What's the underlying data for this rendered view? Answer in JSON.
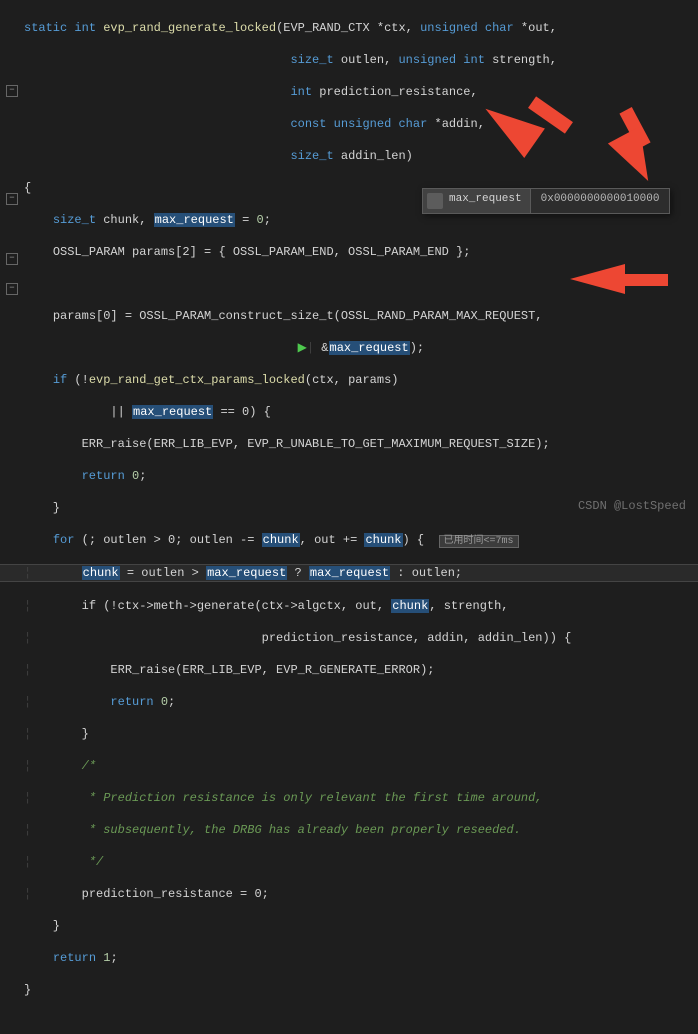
{
  "signature": {
    "keywords": {
      "static": "static",
      "int": "int",
      "unsigned": "unsigned",
      "char": "char",
      "const": "const",
      "size_t": "size_t"
    },
    "fn_name": "evp_rand_generate_locked",
    "params": {
      "p1": "(EVP_RAND_CTX *ctx, ",
      "p2": "*out,",
      "p3": "outlen, ",
      "p4": "strength,",
      "p5": "prediction_resistance,",
      "p6": "*addin,",
      "p7": "addin_len)"
    }
  },
  "body": {
    "decl": {
      "var1": "chunk",
      "var2": "max_request",
      "zero": "0"
    },
    "params_line": "OSSL_PARAM params[2] = { OSSL_PARAM_END, OSSL_PARAM_END };",
    "construct": {
      "lhs": "params[0] = OSSL_PARAM_construct_size_t(OSSL_RAND_PARAM_MAX_REQUEST,",
      "rhs_amp": "&",
      "rhs_var": "max_request",
      "rhs_close": ");"
    },
    "if1": {
      "cond_a": "(!",
      "fn": "evp_rand_get_ctx_params_locked",
      "args": "(ctx, params)",
      "or": "|| ",
      "var": "max_request",
      "eq": " == 0) {"
    },
    "err1": "ERR_raise(ERR_LIB_EVP, EVP_R_UNABLE_TO_GET_MAXIMUM_REQUEST_SIZE);",
    "ret0": "return",
    "ret0_val": "0",
    "for": {
      "head_a": "for",
      "head_b": " (; outlen > 0; outlen -= ",
      "chunk1": "chunk",
      "head_c": ", out += ",
      "chunk2": "chunk",
      "head_d": ") {",
      "badge": "已用时间<=7ms"
    },
    "chunk_assign": {
      "a": "chunk",
      "b": " = outlen > ",
      "c": "max_request",
      "d": " ? ",
      "e": "max_request",
      "f": " : outlen;"
    },
    "if2": {
      "cond": "if (!ctx->meth->generate(ctx->algctx, out, ",
      "chunk": "chunk",
      "rest": ", strength,",
      "line2": "prediction_resistance, addin, addin_len)) {"
    },
    "err2": "ERR_raise(ERR_LIB_EVP, EVP_R_GENERATE_ERROR);",
    "comment": {
      "l1": "/*",
      "l2": " * Prediction resistance is only relevant the first time around,",
      "l3": " * subsequently, the DRBG has already been properly reseeded.",
      "l4": " */"
    },
    "pred_reset": "prediction_resistance = 0;",
    "ret1": "return",
    "ret1_val": "1"
  },
  "tooltip": {
    "name": "max_request",
    "value": "0x0000000000010000"
  },
  "folds": {
    "minus": "−",
    "plus": "+"
  },
  "watermark": "CSDN @LostSpeed",
  "exec_marker": "▶"
}
